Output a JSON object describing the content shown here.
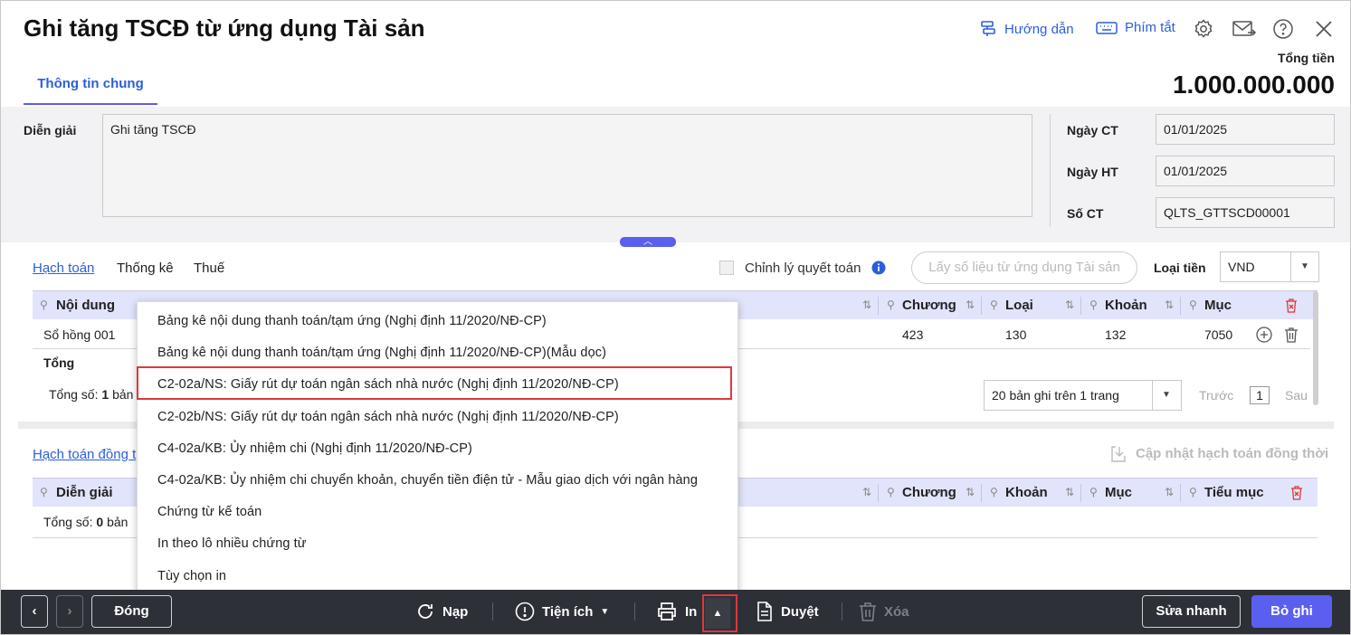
{
  "header": {
    "title": "Ghi tăng TSCĐ từ ứng dụng Tài sản",
    "guide_label": "Hướng dẫn",
    "shortcut_label": "Phím tắt"
  },
  "tabs": [
    {
      "label": "Thông tin chung"
    }
  ],
  "total": {
    "label": "Tổng tiền",
    "value": "1.000.000.000"
  },
  "form": {
    "description_label": "Diễn giải",
    "description_value": "Ghi tăng TSCĐ",
    "date_ct_label": "Ngày CT",
    "date_ct_value": "01/01/2025",
    "date_ht_label": "Ngày HT",
    "date_ht_value": "01/01/2025",
    "doc_no_label": "Số CT",
    "doc_no_value": "QLTS_GTTSCD00001"
  },
  "subtabs": [
    "Hạch toán",
    "Thống kê",
    "Thuế"
  ],
  "settlement_label": "Chỉnh lý quyết toán",
  "fetch_button": "Lấy số liệu từ ứng dụng Tài sản",
  "currency": {
    "label": "Loại tiền",
    "value": "VND"
  },
  "table1": {
    "headers": {
      "noi_dung": "Nội dung",
      "chuong": "Chương",
      "loai": "Loại",
      "khoan": "Khoản",
      "muc": "Mục"
    },
    "row": {
      "noi_dung": "Sổ hồng 001",
      "chuong": "423",
      "loai": "130",
      "khoan": "132",
      "muc": "7050"
    },
    "total_label": "Tổng",
    "count_label": "Tổng số:",
    "count_value": "1",
    "count_suffix": "bản",
    "page_size": "20 bản ghi trên 1 trang",
    "prev": "Trước",
    "page": "1",
    "next": "Sau"
  },
  "table2": {
    "title": "Hạch toán đồng t",
    "update_label": "Cập nhật hạch toán đồng thời",
    "headers": {
      "dien_giai": "Diễn giải",
      "chuong": "Chương",
      "khoan": "Khoản",
      "muc": "Mục",
      "tieu_muc": "Tiểu mục"
    },
    "count_label": "Tổng số:",
    "count_value": "0",
    "count_suffix": "bản"
  },
  "print_menu": [
    "Bảng kê nội dung thanh toán/tạm ứng (Nghị định 11/2020/NĐ-CP)",
    "Bảng kê nội dung thanh toán/tạm ứng (Nghị định 11/2020/NĐ-CP)(Mẫu dọc)",
    "C2-02a/NS: Giấy rút dự toán ngân sách nhà nước (Nghị định 11/2020/NĐ-CP)",
    "C2-02b/NS: Giấy rút dự toán ngân sách nhà nước (Nghị định 11/2020/NĐ-CP)",
    "C4-02a/KB: Ủy nhiệm chi (Nghị định 11/2020/NĐ-CP)",
    "C4-02a/KB: Ủy nhiệm chi chuyển khoản, chuyển tiền điện tử - Mẫu giao dịch với ngân hàng",
    "Chứng từ kế toán",
    "In theo lô nhiều chứng từ",
    "Tùy chọn in"
  ],
  "footer": {
    "close": "Đóng",
    "reload": "Nạp",
    "utilities": "Tiện ích",
    "print": "In",
    "approve": "Duyệt",
    "delete": "Xóa",
    "quick_edit": "Sửa nhanh",
    "unpost": "Bỏ ghi"
  },
  "colors": {
    "accent": "#5b5fef",
    "link": "#2b5fd9",
    "highlight": "#e0383c",
    "footer": "#2d3037"
  }
}
